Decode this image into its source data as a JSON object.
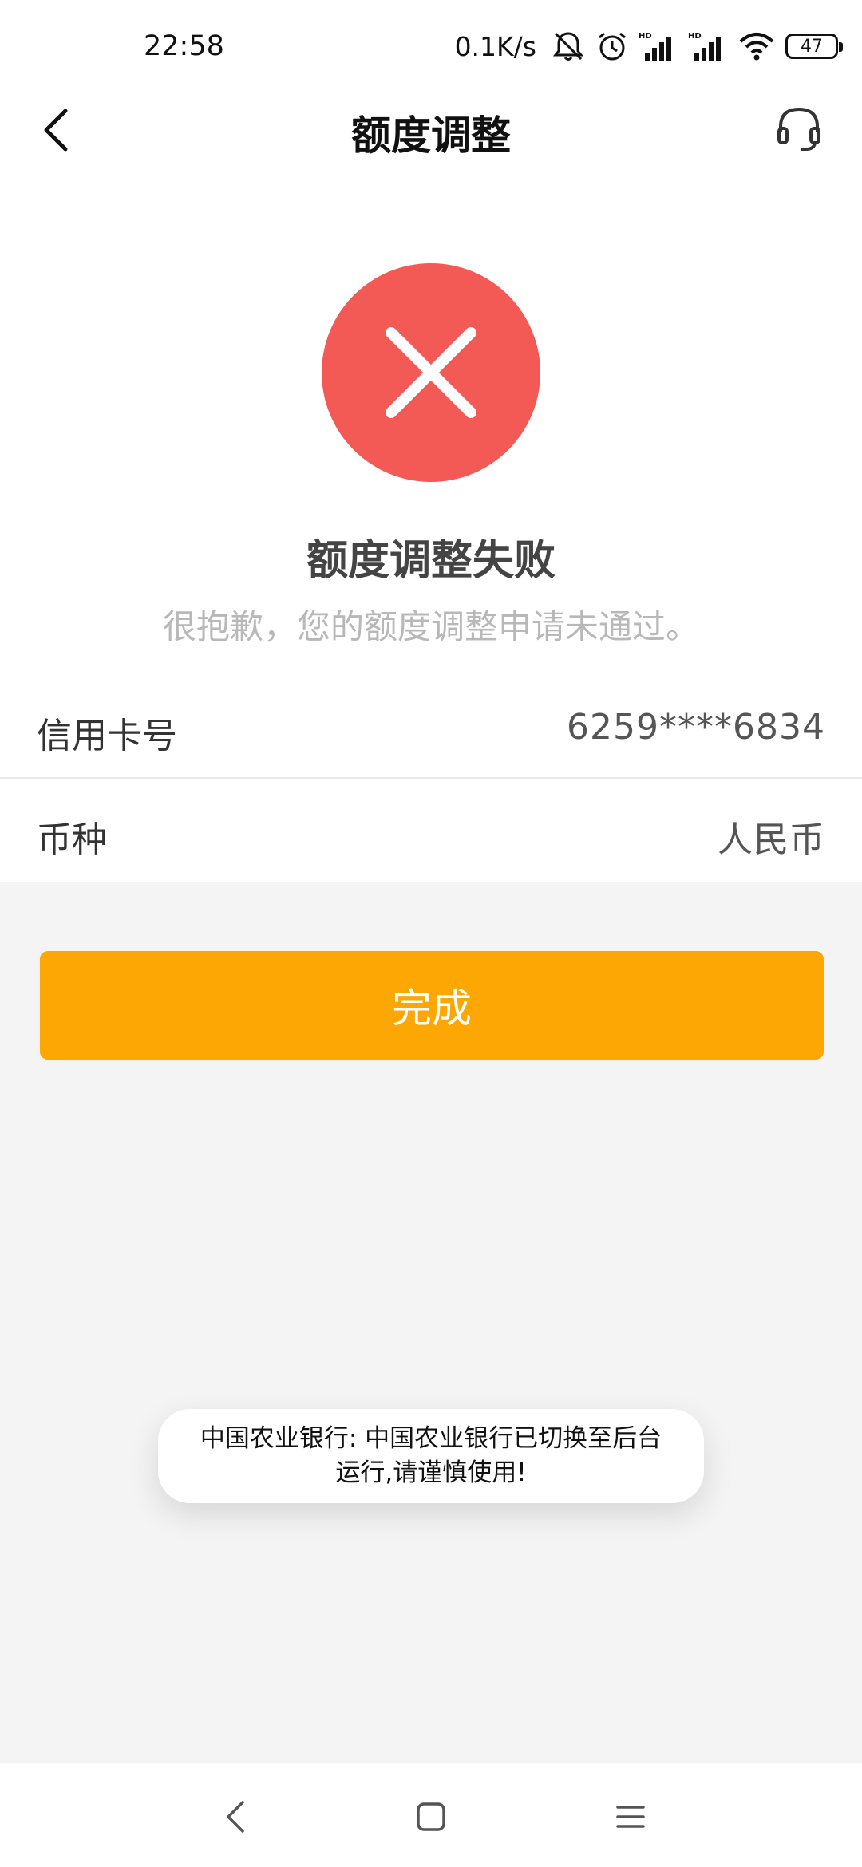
{
  "status_bar": {
    "time": "22:58",
    "net_speed": "0.1K/s",
    "battery": "47",
    "icons": [
      "mute-icon",
      "alarm-icon",
      "hd-signal-icon",
      "hd-signal-icon",
      "wifi-icon",
      "battery-icon"
    ]
  },
  "navbar": {
    "title": "额度调整",
    "back_icon": "chevron-left-icon",
    "service_icon": "headset-icon"
  },
  "result": {
    "icon": "close-icon",
    "icon_color": "#f35a55",
    "title": "额度调整失败",
    "description": "很抱歉，您的额度调整申请未通过。"
  },
  "details": {
    "card": {
      "label": "信用卡号",
      "value": "6259****6834"
    },
    "currency": {
      "label": "币种",
      "value": "人民币"
    }
  },
  "actions": {
    "done_label": "完成",
    "accent_color": "#fca703"
  },
  "toast": {
    "message": "中国农业银行: 中国农业银行已切换至后台运行,请谨慎使用!"
  },
  "system_nav": {
    "items": [
      "back-icon",
      "home-icon",
      "menu-icon"
    ]
  }
}
